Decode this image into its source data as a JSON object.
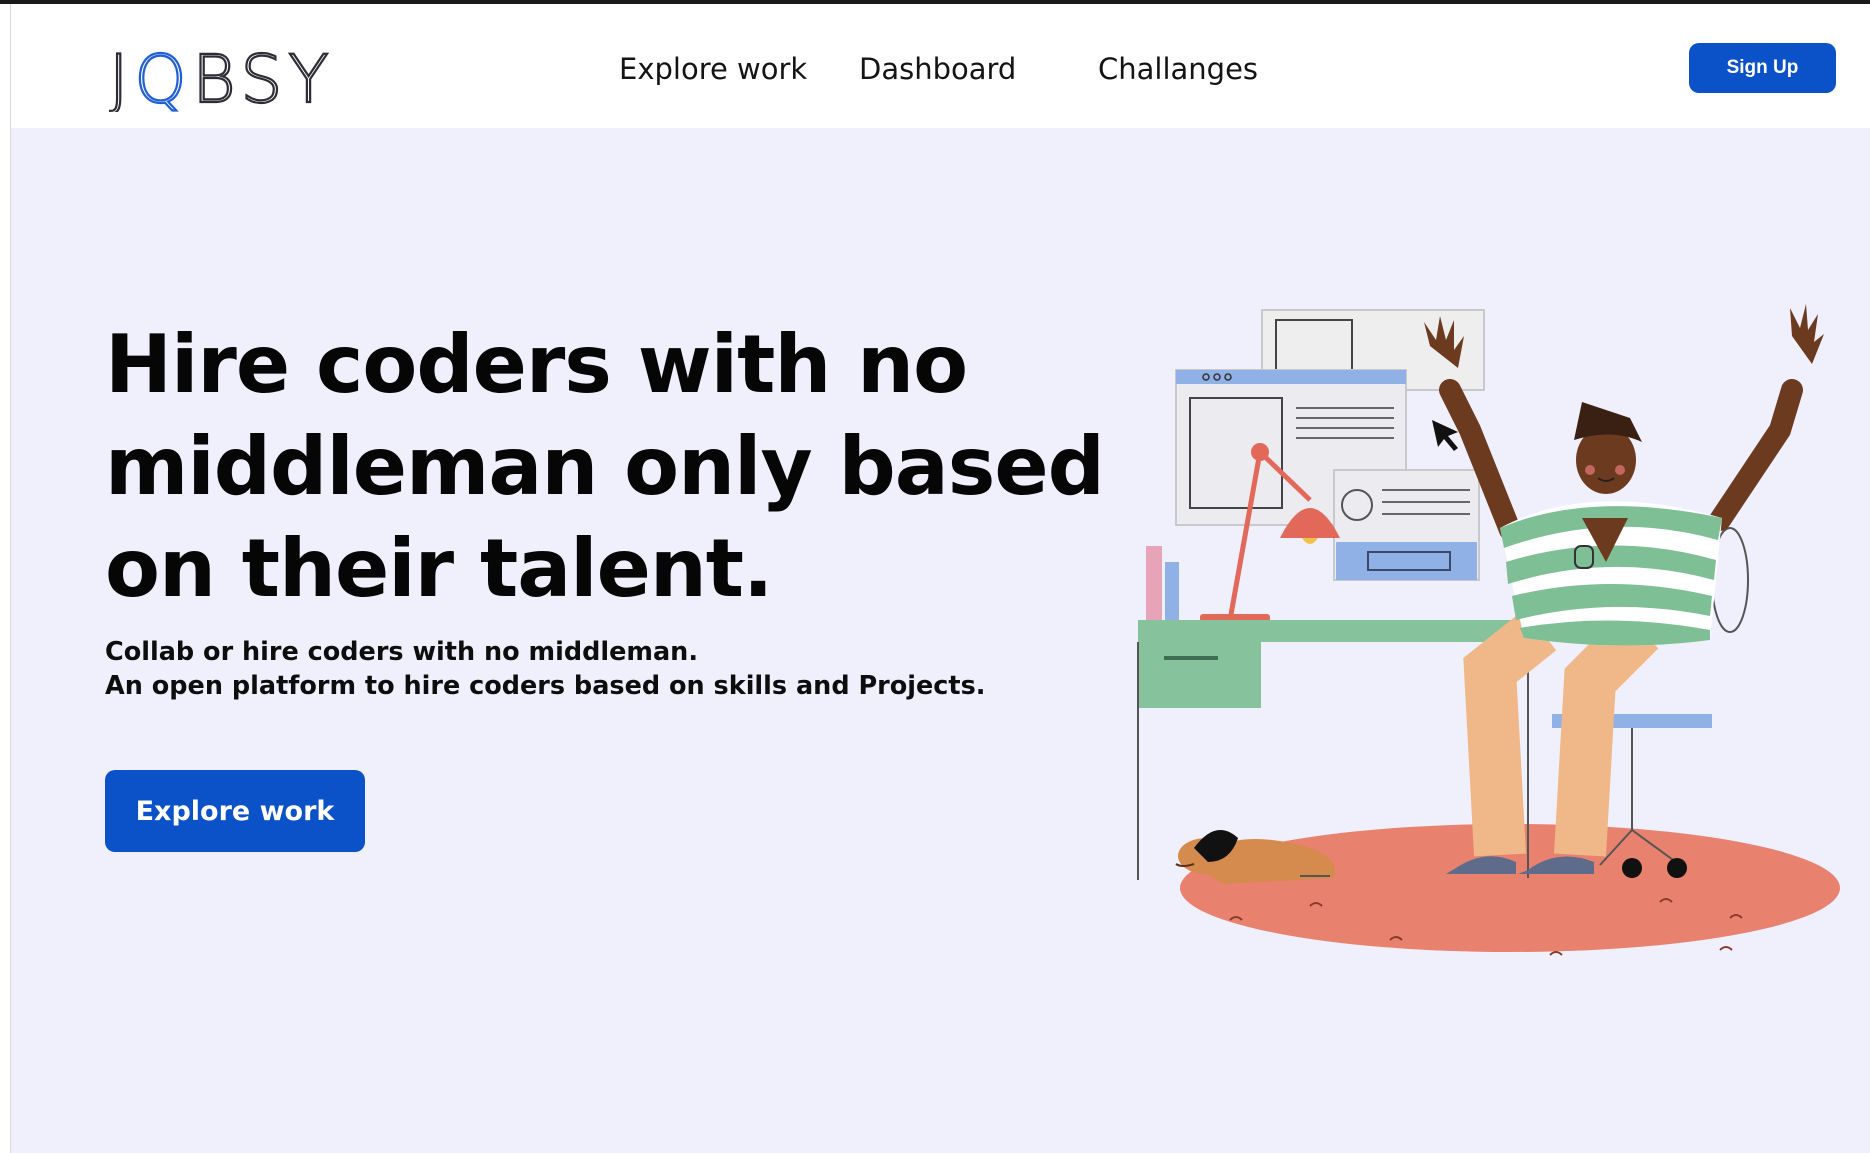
{
  "header": {
    "logo_text": "JQBSY",
    "nav": [
      {
        "label": "Explore work"
      },
      {
        "label": "Dashboard"
      },
      {
        "label": "Challanges"
      }
    ],
    "signup_label": "Sign Up"
  },
  "hero": {
    "headline": "Hire coders with no middleman only based on their talent.",
    "subtext_lines": [
      "Collab or hire coders with no middleman.",
      "An open platform to hire coders based on skills and Projects."
    ],
    "cta_label": "Explore work"
  },
  "colors": {
    "accent": "#0b52c9",
    "hero_background": "#f0effc",
    "rug": "#e8826e",
    "desk": "#86c39d",
    "shirt_stripes": "#7fbf96"
  },
  "icons": [
    "cursor-arrow-icon"
  ]
}
